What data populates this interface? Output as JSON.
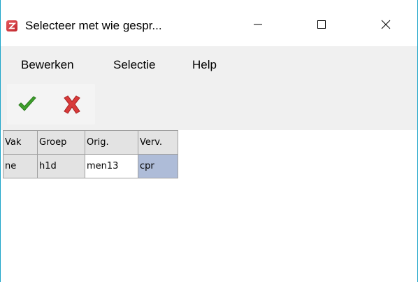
{
  "window": {
    "title": "Selecteer met wie gespr...",
    "icon": "z-app-icon",
    "controls": {
      "minimize": "minimize-icon",
      "maximize": "maximize-icon",
      "close": "close-icon"
    },
    "border_color": "#1aa3c8"
  },
  "menu": {
    "items": [
      "Bewerken",
      "Selectie",
      "Help"
    ]
  },
  "toolbar": {
    "buttons": [
      {
        "name": "ok",
        "icon": "checkmark-icon",
        "color": "#3ea02b"
      },
      {
        "name": "cancel",
        "icon": "cross-icon",
        "color": "#d93a3a"
      }
    ]
  },
  "grid": {
    "headers": [
      "Vak",
      "Groep",
      "Orig.",
      "Verv."
    ],
    "rows": [
      [
        "ne",
        "h1d",
        "men13",
        "cpr"
      ]
    ],
    "colors": {
      "cell_bg": "#e3e3e3",
      "edit_bg": "#ffffff",
      "selected_bg": "#aebcd8"
    }
  }
}
